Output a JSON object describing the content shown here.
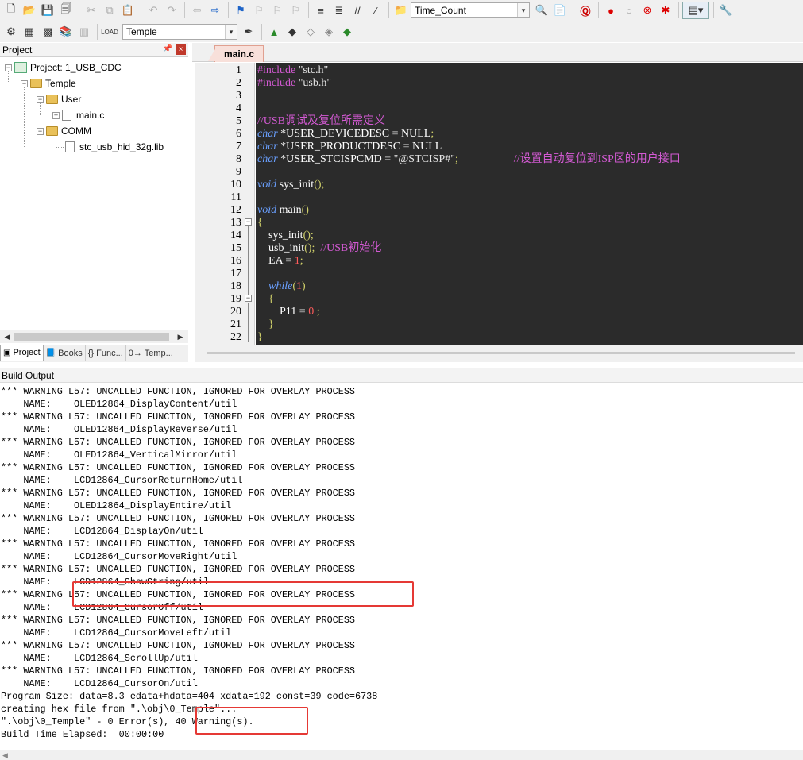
{
  "toolbar1": {
    "target_name": "Time_Count"
  },
  "toolbar2": {
    "target_select": "Temple"
  },
  "project_pane": {
    "title": "Project",
    "tree": {
      "project": "Project: 1_USB_CDC",
      "group": "Temple",
      "user": "User",
      "main_file": "main.c",
      "comm": "COMM",
      "lib": "stc_usb_hid_32g.lib"
    },
    "tabs": [
      "Project",
      "Books",
      "{} Func...",
      "0→ Temp..."
    ]
  },
  "editor": {
    "tab_label": "main.c",
    "line_numbers": [
      "1",
      "2",
      "3",
      "4",
      "5",
      "6",
      "7",
      "8",
      "9",
      "10",
      "11",
      "12",
      "13",
      "14",
      "15",
      "16",
      "17",
      "18",
      "19",
      "20",
      "21",
      "22"
    ],
    "lines": {
      "l1_kw": "#include",
      "l1_str": "\"stc.h\"",
      "l2_kw": "#include",
      "l2_str": "\"usb.h\"",
      "l5_comment": "//USB调试及复位所需定义",
      "l6_kw": "char",
      "l6_p1": "*",
      "l6_name": "USER_DEVICEDESC",
      "l6_eq": "=",
      "l6_val": "NULL",
      "l6_semi": ";",
      "l7_kw": "char",
      "l7_p1": "*",
      "l7_name": "USER_PRODUCTDESC",
      "l7_eq": "=",
      "l7_val": "NULL",
      "l8_kw": "char",
      "l8_p1": "*",
      "l8_name": "USER_STCISPCMD",
      "l8_eq": "=",
      "l8_str": "\"@STCISP#\"",
      "l8_semi": ";",
      "l8_comment": "//设置自动复位到ISP区的用户接口",
      "l10_kw": "void",
      "l10_name": "sys_init",
      "l10_punc": "();",
      "l12_kw": "void",
      "l12_name": "main",
      "l12_punc": "()",
      "l13_brace": "{",
      "l14_name": "sys_init",
      "l14_punc": "();",
      "l15_name": "usb_init",
      "l15_punc": "();",
      "l15_comment": "//USB初始化",
      "l16_name": "EA",
      "l16_eq": "=",
      "l16_num": "1",
      "l16_semi": ";",
      "l18_kw": "while",
      "l18_p1": "(",
      "l18_num": "1",
      "l18_p2": ")",
      "l19_brace": "{",
      "l20_name": "P11",
      "l20_eq": "=",
      "l20_num": "0",
      "l20_semi": ";",
      "l21_brace": "}",
      "l22_brace": "}"
    }
  },
  "build_output": {
    "title": "Build Output",
    "lines": [
      "*** WARNING L57: UNCALLED FUNCTION, IGNORED FOR OVERLAY PROCESS",
      "    NAME:    OLED12864_DisplayContent/util",
      "*** WARNING L57: UNCALLED FUNCTION, IGNORED FOR OVERLAY PROCESS",
      "    NAME:    OLED12864_DisplayReverse/util",
      "*** WARNING L57: UNCALLED FUNCTION, IGNORED FOR OVERLAY PROCESS",
      "    NAME:    OLED12864_VerticalMirror/util",
      "*** WARNING L57: UNCALLED FUNCTION, IGNORED FOR OVERLAY PROCESS",
      "    NAME:    LCD12864_CursorReturnHome/util",
      "*** WARNING L57: UNCALLED FUNCTION, IGNORED FOR OVERLAY PROCESS",
      "    NAME:    OLED12864_DisplayEntire/util",
      "*** WARNING L57: UNCALLED FUNCTION, IGNORED FOR OVERLAY PROCESS",
      "    NAME:    LCD12864_DisplayOn/util",
      "*** WARNING L57: UNCALLED FUNCTION, IGNORED FOR OVERLAY PROCESS",
      "    NAME:    LCD12864_CursorMoveRight/util",
      "*** WARNING L57: UNCALLED FUNCTION, IGNORED FOR OVERLAY PROCESS",
      "    NAME:    LCD12864_ShowString/util",
      "*** WARNING L57: UNCALLED FUNCTION, IGNORED FOR OVERLAY PROCESS",
      "    NAME:    LCD12864_CursorOff/util",
      "*** WARNING L57: UNCALLED FUNCTION, IGNORED FOR OVERLAY PROCESS",
      "    NAME:    LCD12864_CursorMoveLeft/util",
      "*** WARNING L57: UNCALLED FUNCTION, IGNORED FOR OVERLAY PROCESS",
      "    NAME:    LCD12864_ScrollUp/util",
      "*** WARNING L57: UNCALLED FUNCTION, IGNORED FOR OVERLAY PROCESS",
      "    NAME:    LCD12864_CursorOn/util",
      "Program Size: data=8.3 edata+hdata=404 xdata=192 const=39 code=6738",
      "creating hex file from \".\\obj\\0_Temple\"...",
      "\".\\obj\\0_Temple\" - 0 Error(s), 40 Warning(s).",
      "Build Time Elapsed:  00:00:00"
    ]
  },
  "colors": {
    "annotation_box": "#e53935",
    "editor_bg": "#2b2b2b"
  },
  "icons": [
    "new-file-icon",
    "open-icon",
    "save-icon",
    "save-all-icon",
    "cut-icon",
    "copy-icon",
    "paste-icon",
    "undo-icon",
    "redo-icon",
    "nav-back-icon",
    "nav-forward-icon",
    "bookmark-icon",
    "indent-icon",
    "outdent-icon",
    "target-options-icon",
    "debug-icon",
    "breakpoint-icon",
    "build-icon",
    "rebuild-icon",
    "download-icon",
    "wrench-icon"
  ]
}
